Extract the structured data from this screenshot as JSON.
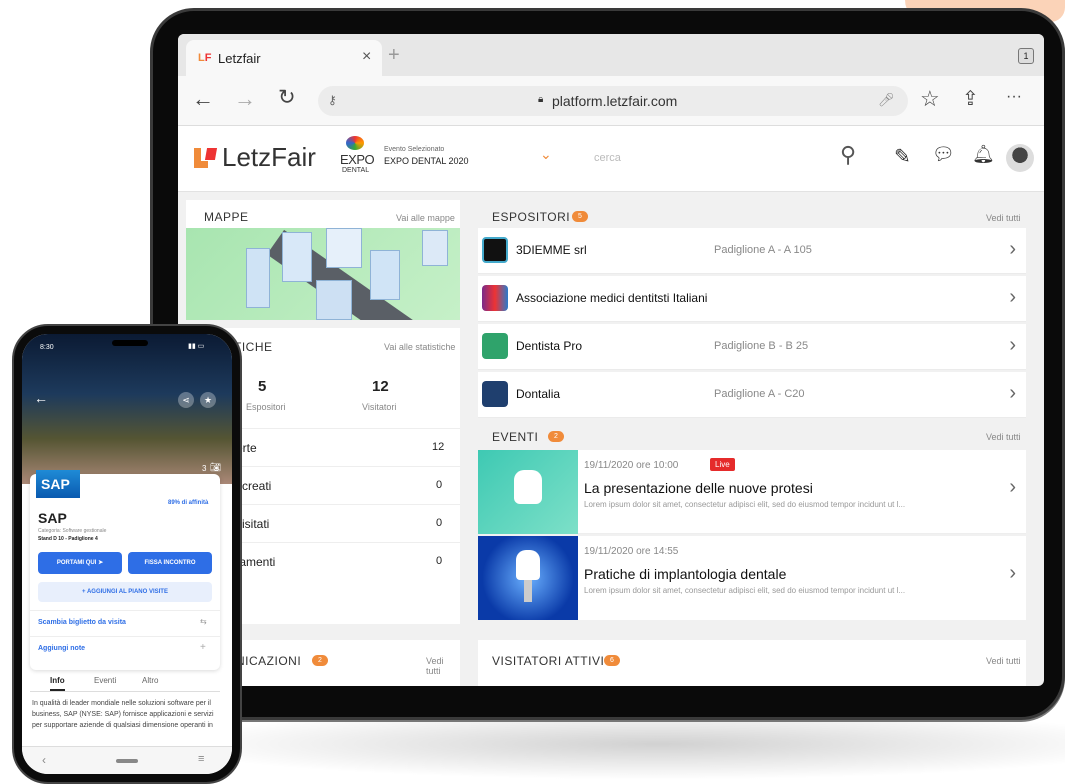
{
  "browser": {
    "tab_title": "Letzfair",
    "tab_count": "1",
    "url": "platform.letzfair.com"
  },
  "header": {
    "brand": "LetzFair",
    "event_logo_line1": "EXPO",
    "event_logo_line2": "DENTAL",
    "event_selected_label": "Evento Selezionato",
    "event_name": "EXPO DENTAL 2020",
    "search_placeholder": "cerca"
  },
  "mappe": {
    "title": "MAPPE",
    "link": "Vai alle mappe"
  },
  "statistiche": {
    "title": "TICHE",
    "link": "Vai alle statistiche",
    "espositori_value": "5",
    "espositori_label": "Espositori",
    "visitatori_value": "12",
    "visitatori_label": "Visitatori",
    "rows": [
      {
        "label": "erte",
        "value": "12"
      },
      {
        "label": "i creati",
        "value": "0"
      },
      {
        "label": "visitati",
        "value": "0"
      },
      {
        "label": "tamenti",
        "value": "0"
      }
    ]
  },
  "espositori": {
    "title": "ESPOSITORI",
    "badge": "5",
    "link": "Vedi tutti",
    "items": [
      {
        "name": "3DIEMME srl",
        "pad": "Padiglione A - A 105",
        "color": "#111"
      },
      {
        "name": "Associazione medici dentitsti Italiani",
        "pad": "",
        "color": "#7a2a8a"
      },
      {
        "name": "Dentista Pro",
        "pad": "Padiglione B - B 25",
        "color": "#2fa36b"
      },
      {
        "name": "Dontalia",
        "pad": "Padiglione A - C20",
        "color": "#1f3f6e"
      }
    ]
  },
  "eventi": {
    "title": "EVENTI",
    "badge": "2",
    "link": "Vedi tutti",
    "items": [
      {
        "date": "19/11/2020 ore 10:00",
        "live": "Live",
        "title": "La presentazione delle nuove protesi",
        "desc": "Lorem ipsum dolor sit amet, consectetur adipisci elit, sed do eiusmod tempor incidunt ut l..."
      },
      {
        "date": "19/11/2020 ore 14:55",
        "live": "",
        "title": "Pratiche di implantologia dentale",
        "desc": "Lorem ipsum dolor sit amet, consectetur adipisci elit, sed do eiusmod tempor incidunt ut l..."
      }
    ]
  },
  "comunicazioni": {
    "title": "NICAZIONI",
    "badge": "2",
    "link": "Vedi tutti"
  },
  "visitatori_attivi": {
    "title": "VISITATORI ATTIVI",
    "badge": "6",
    "link": "Vedi tutti"
  },
  "phone": {
    "time": "8:30",
    "photo_count": "3",
    "company_logo": "SAP",
    "affinity": "89% di affinità",
    "company_name": "SAP",
    "category": "Categoria: Software gestionale",
    "stand": "Stand D 10 - Padiglione 4",
    "btn_portami": "PORTAMI QUI",
    "btn_fissa": "FISSA INCONTRO",
    "btn_aggiungi": "AGGIUNGI AL PIANO VISITE",
    "link_scambia": "Scambia biglietto da visita",
    "link_note": "Aggiungi note",
    "tabs": [
      "Info",
      "Eventi",
      "Altro"
    ],
    "description": "In qualità di leader mondiale nelle soluzioni software per il business, SAP (NYSE: SAP) fornisce applicazioni e servizi per supportare aziende di qualsiasi dimensione operanti in"
  },
  "colors": {
    "accent_orange": "#f08b3a",
    "brand_blue": "#2e6ee6",
    "live_red": "#e52b2b"
  }
}
